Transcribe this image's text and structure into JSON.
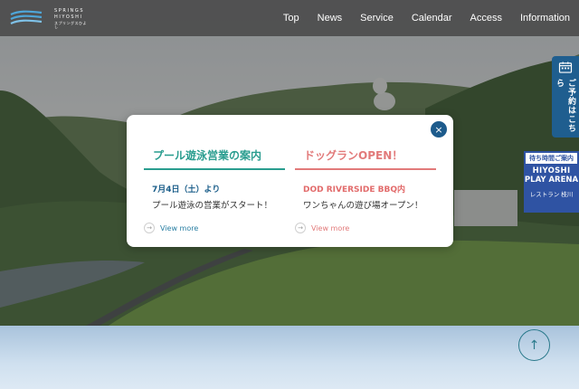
{
  "logo": {
    "line1": "SPRINGS",
    "line2": "HIYOSHI",
    "line3": "スプリングスひよし"
  },
  "nav": {
    "items": [
      "Top",
      "News",
      "Service",
      "Calendar",
      "Access",
      "Information"
    ]
  },
  "modal": {
    "close_icon": "×",
    "left": {
      "heading": "プール遊泳営業の案内",
      "date": "7月4日（土）より",
      "body": "プール遊泳の営業がスタート！",
      "link": "View more"
    },
    "right": {
      "heading": "ドッグランOPEN！",
      "date": "DOD RIVERSIDE BBQ内",
      "body": "ワンちゃんの遊び場オープン！",
      "link": "View more"
    }
  },
  "side": {
    "reserve_label": "ご予約はこちら",
    "play_top": "待ち時間ご案内",
    "play_line1": "HIYOSHI",
    "play_line2": "PLAY ARENA",
    "play_sub": "レストラン 枝川"
  },
  "colors": {
    "accent_teal": "#2a9d8f",
    "accent_pink": "#e27a7a",
    "brand_blue": "#1f5e8f"
  },
  "icons": {
    "close": "close-icon",
    "calendar": "calendar-icon",
    "arrow": "arrow-right-icon",
    "scroll_top": "arrow-up-icon"
  },
  "scroll_top_glyph": "↑"
}
